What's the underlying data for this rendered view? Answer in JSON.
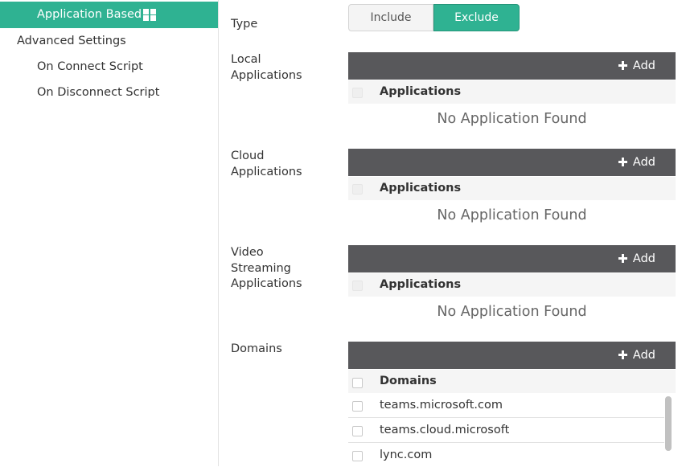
{
  "sidebar": {
    "items": [
      {
        "label": "Application Based",
        "active": true,
        "icon": "windows-icon"
      },
      {
        "label": "Advanced Settings"
      },
      {
        "label": "On Connect Script"
      },
      {
        "label": "On Disconnect Script"
      }
    ]
  },
  "form": {
    "type_label": "Type",
    "toggle": {
      "include_label": "Include",
      "exclude_label": "Exclude",
      "selected": "Exclude"
    },
    "local": {
      "label_line1": "Local",
      "label_line2": "Applications",
      "add_label": "Add",
      "column": "Applications",
      "empty": "No Application Found"
    },
    "cloud": {
      "label_line1": "Cloud",
      "label_line2": "Applications",
      "add_label": "Add",
      "column": "Applications",
      "empty": "No Application Found"
    },
    "video": {
      "label_line1": "Video",
      "label_line2": "Streaming",
      "label_line3": "Applications",
      "add_label": "Add",
      "column": "Applications",
      "empty": "No Application Found"
    },
    "domains": {
      "label": "Domains",
      "add_label": "Add",
      "column": "Domains",
      "rows": [
        "teams.microsoft.com",
        "teams.cloud.microsoft",
        "lync.com"
      ]
    }
  },
  "colors": {
    "accent": "#2fb292",
    "panel_bar": "#58585b"
  }
}
